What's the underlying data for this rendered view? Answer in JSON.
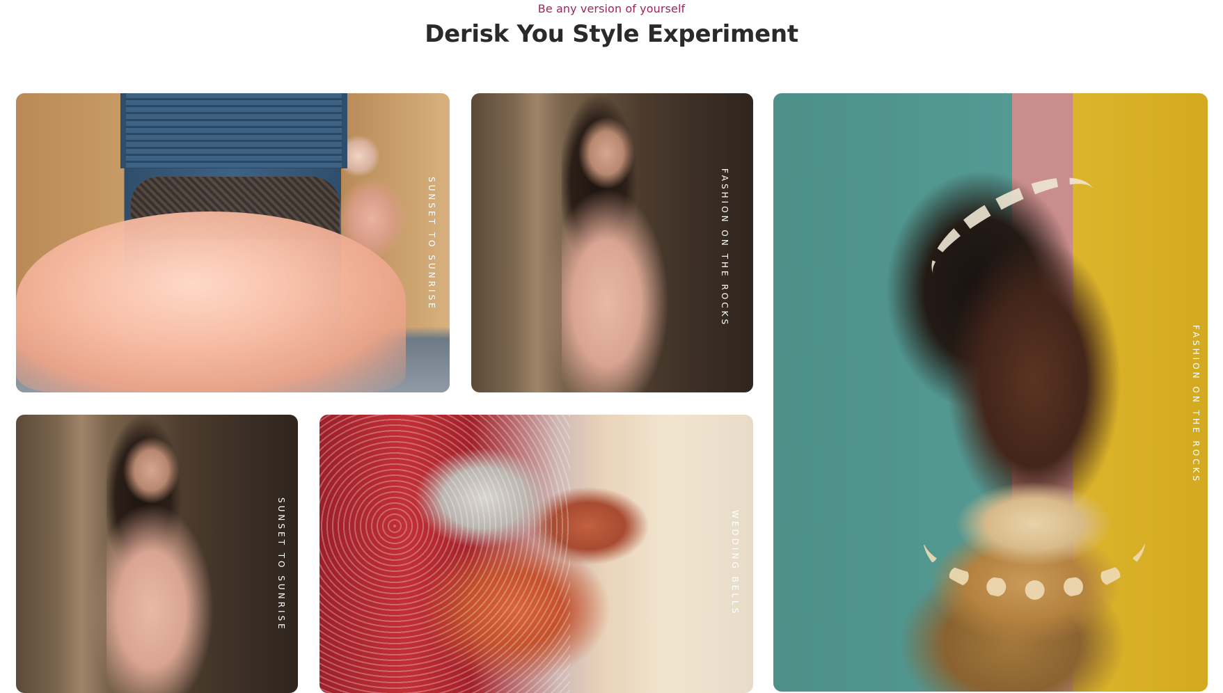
{
  "header": {
    "tagline": "Be any version of yourself",
    "title": "Derisk You Style Experiment"
  },
  "gallery": {
    "cards": [
      {
        "label": "Sunset to sunrise"
      },
      {
        "label": "Fashion on the rocks"
      },
      {
        "label": "Fashion on the rocks"
      },
      {
        "label": "Sunset to sunrise"
      },
      {
        "label": "Wedding bells"
      }
    ]
  },
  "colors": {
    "tagline": "#a0235c",
    "title": "#2a2a2a",
    "label": "#ffffff"
  }
}
